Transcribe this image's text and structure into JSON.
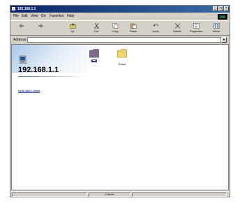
{
  "window": {
    "title": "192.168.1.1",
    "controls": {
      "minimize": "_",
      "maximize": "□",
      "close": "×"
    }
  },
  "menu": {
    "items": [
      "File",
      "Edit",
      "View",
      "Go",
      "Favorites",
      "Help"
    ]
  },
  "toolbar": {
    "buttons": [
      {
        "label": "",
        "icon": "back-arrow-icon"
      },
      {
        "label": "",
        "icon": "forward-arrow-icon"
      },
      {
        "label": "Up",
        "icon": "up-folder-icon"
      },
      {
        "label": "Cut",
        "icon": "scissors-icon"
      },
      {
        "label": "Copy",
        "icon": "copy-icon"
      },
      {
        "label": "Paste",
        "icon": "paste-icon"
      },
      {
        "label": "Undo",
        "icon": "undo-icon"
      },
      {
        "label": "Delete",
        "icon": "delete-x-icon"
      },
      {
        "label": "Properties",
        "icon": "properties-icon"
      },
      {
        "label": "Views",
        "icon": "views-icon"
      }
    ]
  },
  "address": {
    "label": "Address",
    "value": "",
    "dropdown": "▼"
  },
  "content": {
    "host": "192.168.1.1",
    "link": "\\\\192.168.1.1\\rbd",
    "items": [
      {
        "label": "",
        "icon": "printers-folder-icon"
      },
      {
        "label": "Share",
        "icon": "shared-folder-icon"
      }
    ]
  },
  "status": {
    "center_text": "0 items"
  },
  "colors": {
    "window_bg": "#d4d0c8",
    "titlebar": "#0a246a",
    "link": "#1a2e8f"
  }
}
